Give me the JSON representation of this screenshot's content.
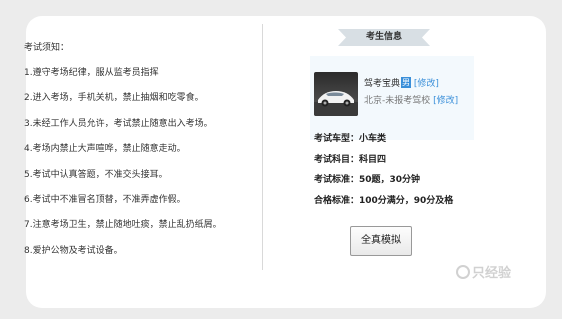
{
  "notice": {
    "title": "考试须知：",
    "rules": [
      "1.遵守考场纪律，服从监考员指挥",
      "2.进入考场，手机关机，禁止抽烟和吃零食。",
      "3.未经工作人员允许，考试禁止随意出入考场。",
      "4.考场内禁止大声喧哗，禁止随意走动。",
      "5.考试中认真答题，不准交头接耳。",
      "6.考试中不准冒名顶替，不准弄虚作假。",
      "7.注意考场卫生，禁止随地吐痰，禁止乱扔纸屑。",
      "8.爱护公物及考试设备。"
    ]
  },
  "candidate": {
    "section_title": "考生信息",
    "username": "驾考宝典",
    "gender": "男",
    "edit_label": "[修改]",
    "school": "北京-未报考驾校",
    "school_edit_label": "[修改]",
    "info_rows": [
      "考试车型：小车类",
      "考试科目：科目四",
      "考试标准：50题，30分钟",
      "合格标准：100分满分，90分及格"
    ],
    "simulate_button": "全真模拟"
  },
  "watermark": {
    "text": "只经验"
  },
  "colors": {
    "background": "#ececec",
    "card": "#ffffff",
    "ribbon": "#d8dfe4",
    "link": "#3a8fd9",
    "avatar_box": "#f3f9fd"
  }
}
